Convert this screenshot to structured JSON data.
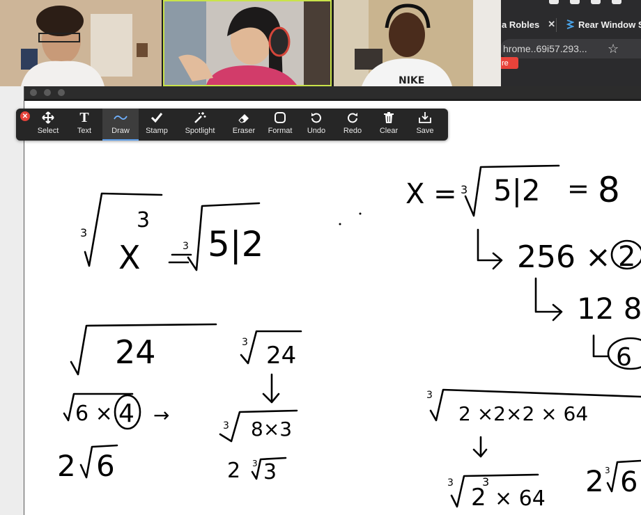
{
  "browser": {
    "tab1_label": "a Robles",
    "tab2_label": "Rear Window S",
    "url_text": "hrome..69i57.293...",
    "chip_text": "re"
  },
  "participants": [
    {
      "name": "",
      "speaking": false
    },
    {
      "name": "",
      "speaking": true
    },
    {
      "name": "",
      "speaking": false
    }
  ],
  "toolbar": {
    "items": [
      {
        "key": "select",
        "label": "Select",
        "icon": "move-arrows-icon"
      },
      {
        "key": "text",
        "label": "Text",
        "icon": "text-t-icon"
      },
      {
        "key": "draw",
        "label": "Draw",
        "icon": "squiggle-icon",
        "active": true
      },
      {
        "key": "stamp",
        "label": "Stamp",
        "icon": "checkmark-icon"
      },
      {
        "key": "spotlight",
        "label": "Spotlight",
        "icon": "magic-wand-icon"
      },
      {
        "key": "eraser",
        "label": "Eraser",
        "icon": "eraser-icon"
      },
      {
        "key": "format",
        "label": "Format",
        "icon": "rounded-square-icon"
      },
      {
        "key": "undo",
        "label": "Undo",
        "icon": "undo-icon"
      },
      {
        "key": "redo",
        "label": "Redo",
        "icon": "redo-icon"
      },
      {
        "key": "clear",
        "label": "Clear",
        "icon": "trash-icon"
      },
      {
        "key": "save",
        "label": "Save",
        "icon": "save-tray-icon"
      }
    ]
  },
  "whiteboard": {
    "eq1": {
      "index": "3",
      "radicand_base": "X",
      "radicand_exp": "3",
      "eq": "=",
      "rhs_index": "3",
      "rhs": "5|2"
    },
    "eq2": {
      "lhs": "X =",
      "index": "3",
      "radicand": "5|2",
      "eq": "=",
      "result": "8"
    },
    "factor1": {
      "prefix": "↳",
      "text": "256 ×",
      "circled": "2"
    },
    "factor2": {
      "prefix": "↳",
      "text": "12 8"
    },
    "factor3": {
      "prefix": "↳",
      "circled": "6"
    },
    "sqrt24": {
      "radicand": "24"
    },
    "cbrt24": {
      "index": "3",
      "radicand": "24"
    },
    "sqrt6x4": {
      "text": "6 ×",
      "circled": "4",
      "arrow": "→"
    },
    "cbrt8x3": {
      "index": "3",
      "radicand": "8×3"
    },
    "two_sqrt6": {
      "coef": "2",
      "radicand": "6"
    },
    "two_cbrt3": {
      "coef": "2",
      "index": "3",
      "radicand": "3"
    },
    "cbrt_long": {
      "index": "3",
      "radicand": "2 ×2×2 × 64"
    },
    "cbrt_pow": {
      "index": "3",
      "base": "2",
      "exp": "3",
      "rest": "× 64"
    },
    "two_cbrt6": {
      "coef": "2",
      "index": "3",
      "radicand": "6"
    }
  }
}
